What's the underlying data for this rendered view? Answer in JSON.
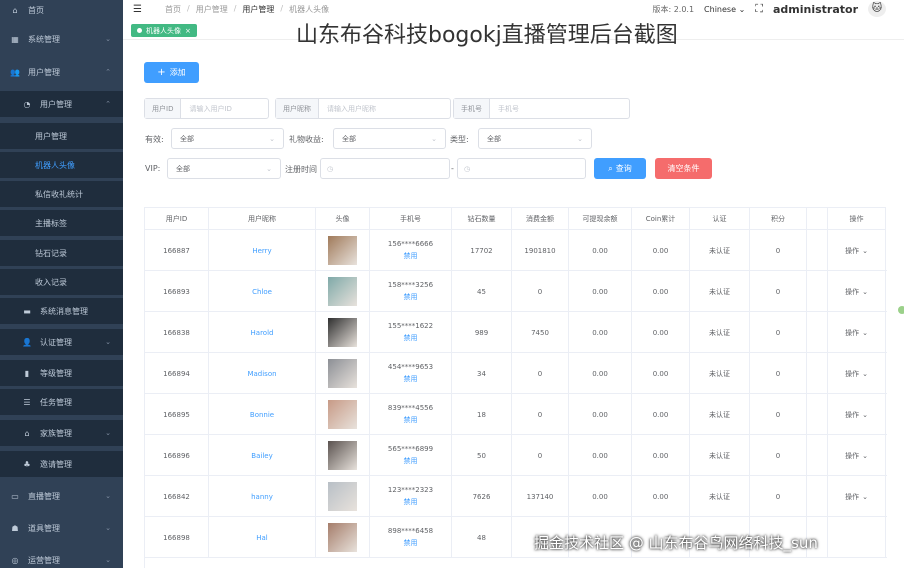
{
  "sidebar": {
    "items": [
      {
        "icon": "dashboard-icon",
        "glyph": "⌂",
        "label": "首页",
        "level": 1
      },
      {
        "icon": "grid-icon",
        "glyph": "▦",
        "label": "系统管理",
        "level": 1,
        "chev": "⌄"
      },
      {
        "icon": "users-icon",
        "glyph": "👥",
        "label": "用户管理",
        "level": 1,
        "chev": "⌃"
      },
      {
        "icon": "user-icon",
        "glyph": "◔",
        "label": "用户管理",
        "level": 2,
        "chev": "⌃"
      },
      {
        "label": "用户管理",
        "level": 3
      },
      {
        "label": "机器人头像",
        "level": 3,
        "active": true
      },
      {
        "label": "私信收礼统计",
        "level": 3
      },
      {
        "label": "主播标签",
        "level": 3
      },
      {
        "label": "钻石记录",
        "level": 3
      },
      {
        "label": "收入记录",
        "level": 3
      },
      {
        "icon": "message-icon",
        "glyph": "▬",
        "label": "系统消息管理",
        "level": 2
      },
      {
        "icon": "verify-icon",
        "glyph": "👤",
        "label": "认证管理",
        "level": 2,
        "chev": "⌄"
      },
      {
        "icon": "level-icon",
        "glyph": "▮",
        "label": "等级管理",
        "level": 2
      },
      {
        "icon": "task-icon",
        "glyph": "☰",
        "label": "任务管理",
        "level": 2
      },
      {
        "icon": "family-icon",
        "glyph": "⌂",
        "label": "家族管理",
        "level": 2,
        "chev": "⌄"
      },
      {
        "icon": "invite-icon",
        "glyph": "♣",
        "label": "邀请管理",
        "level": 2
      },
      {
        "icon": "live-icon",
        "glyph": "▭",
        "label": "直播管理",
        "level": 1,
        "chev": "⌄"
      },
      {
        "icon": "props-icon",
        "glyph": "☗",
        "label": "道具管理",
        "level": 1,
        "chev": "⌄"
      },
      {
        "icon": "ops-icon",
        "glyph": "◎",
        "label": "运营管理",
        "level": 1,
        "chev": "⌄"
      }
    ]
  },
  "header": {
    "breadcrumb": [
      "首页",
      "用户管理",
      "用户管理",
      "机器人头像"
    ],
    "sep": "/",
    "version": "版本: 2.0.1",
    "language": "Chinese",
    "lang_chev": "⌄",
    "username": "administrator",
    "menu_icon": "☰",
    "fullscreen_icon": "⛶",
    "avatar_glyph": "🐱"
  },
  "tag": {
    "label": "机器人头像",
    "close": "×"
  },
  "overlay_title": "山东布谷科技bogokj直播管理后台截图",
  "filters": {
    "add_label": "添加",
    "add_glyph": "+",
    "uid": {
      "prefix": "用户ID",
      "placeholder": "请输入用户ID"
    },
    "nick": {
      "prefix": "用户昵称",
      "placeholder": "请输入用户昵称"
    },
    "phone": {
      "prefix": "手机号",
      "placeholder": "手机号"
    },
    "valid_label": "有效:",
    "valid_value": "全部",
    "gift_label": "礼物收益:",
    "gift_value": "全部",
    "type_label": "类型:",
    "type_value": "全部",
    "vip_label": "VIP:",
    "vip_value": "全部",
    "reg_label": "注册时间",
    "date_sep": "-",
    "date_glyph": "◷",
    "arrow_glyph": "⌄",
    "search_label": "查询",
    "search_glyph": "⌕",
    "clear_label": "清空条件"
  },
  "table": {
    "headers": [
      "用户ID",
      "用户昵称",
      "头像",
      "手机号",
      "钻石数量",
      "消费金额",
      "可提现余额",
      "Coin累计",
      "认证",
      "积分",
      "",
      "操作"
    ],
    "ban_label": "禁用",
    "op_label": "操作",
    "op_chev": "⌄",
    "rows": [
      {
        "id": "166887",
        "nick": "Herry",
        "phone": "156****6666",
        "diamond": "17702",
        "spend": "1901810",
        "balance": "0.00",
        "coin": "0.00",
        "auth": "未认证",
        "points": "0",
        "color": "#a07a5a"
      },
      {
        "id": "166893",
        "nick": "Chloe",
        "phone": "158****3256",
        "diamond": "45",
        "spend": "0",
        "balance": "0.00",
        "coin": "0.00",
        "auth": "未认证",
        "points": "0",
        "color": "#7fa9a8"
      },
      {
        "id": "166838",
        "nick": "Harold",
        "phone": "155****1622",
        "diamond": "989",
        "spend": "7450",
        "balance": "0.00",
        "coin": "0.00",
        "auth": "未认证",
        "points": "0",
        "color": "#2f2f2f"
      },
      {
        "id": "166894",
        "nick": "Madison",
        "phone": "454****9653",
        "diamond": "34",
        "spend": "0",
        "balance": "0.00",
        "coin": "0.00",
        "auth": "未认证",
        "points": "0",
        "color": "#8c8f95"
      },
      {
        "id": "166895",
        "nick": "Bonnie",
        "phone": "839****4556",
        "diamond": "18",
        "spend": "0",
        "balance": "0.00",
        "coin": "0.00",
        "auth": "未认证",
        "points": "0",
        "color": "#c79a86"
      },
      {
        "id": "166896",
        "nick": "Bailey",
        "phone": "565****6899",
        "diamond": "50",
        "spend": "0",
        "balance": "0.00",
        "coin": "0.00",
        "auth": "未认证",
        "points": "0",
        "color": "#5a524f"
      },
      {
        "id": "166842",
        "nick": "hanny",
        "phone": "123****2323",
        "diamond": "7626",
        "spend": "137140",
        "balance": "0.00",
        "coin": "0.00",
        "auth": "未认证",
        "points": "0",
        "color": "#b8bfc6"
      },
      {
        "id": "166898",
        "nick": "Hal",
        "phone": "898****6458",
        "diamond": "48",
        "spend": "",
        "balance": "",
        "coin": "",
        "auth": "",
        "points": "",
        "color": "#a57d6a"
      }
    ]
  },
  "footer_watermark": "掘金技术社区 @ 山东布谷鸟网络科技_sun"
}
